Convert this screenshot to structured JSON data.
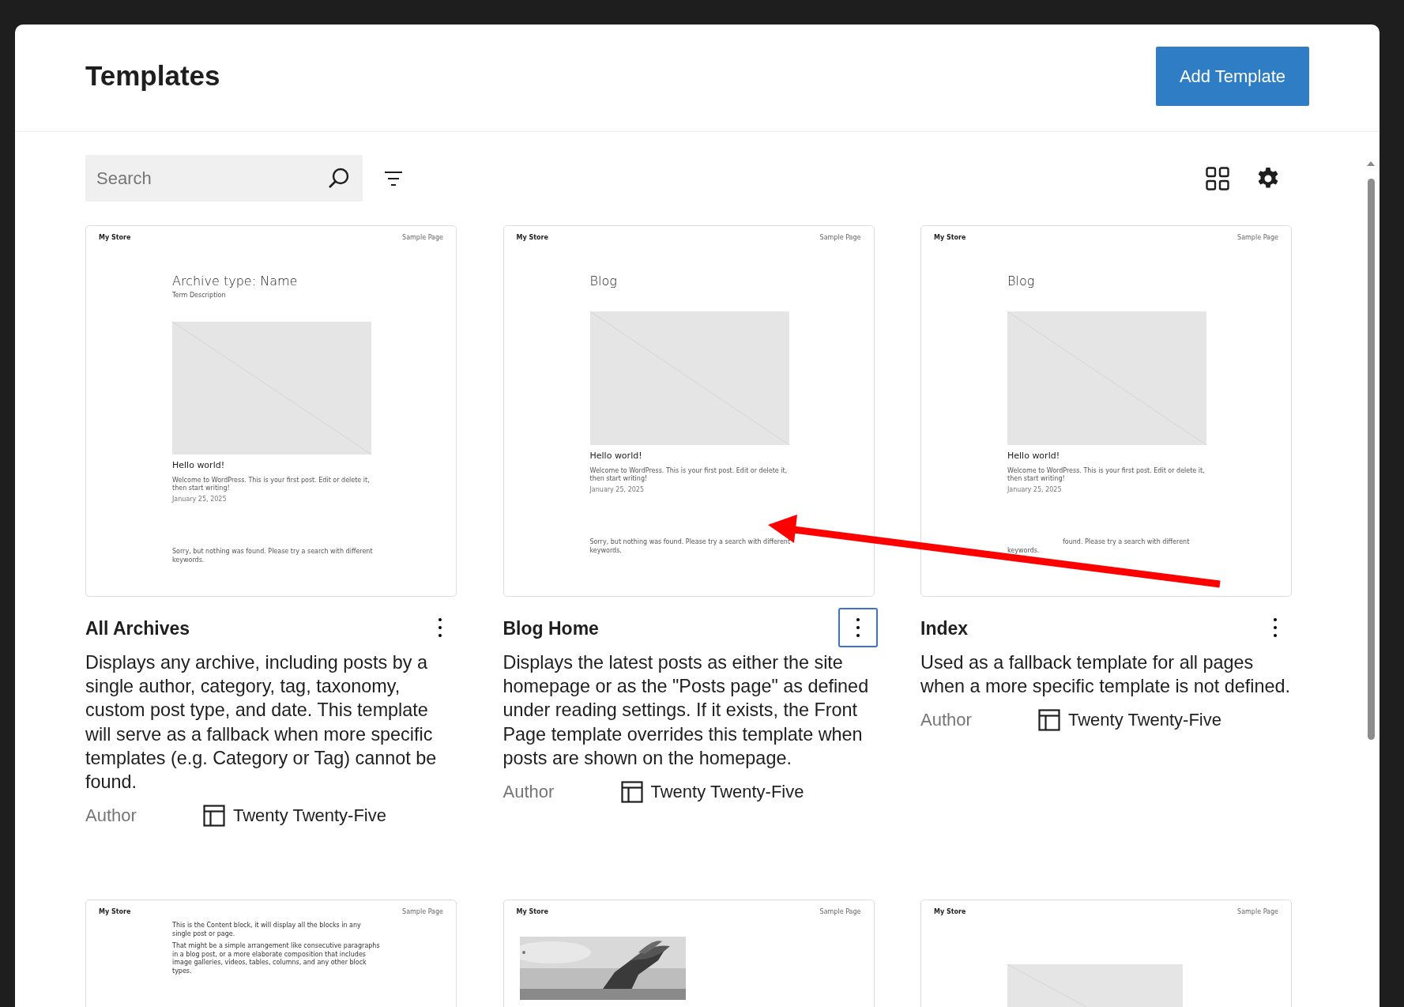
{
  "header": {
    "title": "Templates",
    "add_button": "Add Template"
  },
  "toolbar": {
    "search": {
      "placeholder": "Search"
    }
  },
  "templates": [
    {
      "title": "All Archives",
      "description": "Displays any archive, including posts by a single author, category, tag, taxonomy, custom post type, and date. This template will serve as a fallback when more specific templates (e.g. Category or Tag) cannot be found.",
      "author_label": "Author",
      "theme": "Twenty Twenty-Five",
      "menu_focused": false,
      "preview": {
        "kind": "posts",
        "site_title": "My Store",
        "nav": "Sample Page",
        "heading": "Archive type: Name",
        "subheading": "Term Description",
        "post_title": "Hello world!",
        "excerpt": "Welcome to WordPress. This is your first post. Edit or delete it, then start writing!",
        "date": "January 25, 2025",
        "notice": "Sorry, but nothing was found. Please try a search with different keywords.",
        "notice_covered": false
      }
    },
    {
      "title": "Blog Home",
      "description": "Displays the latest posts as either the site homepage or as the \"Posts page\" as defined under reading settings. If it exists, the Front Page template overrides this template when posts are shown on the homepage.",
      "author_label": "Author",
      "theme": "Twenty Twenty-Five",
      "menu_focused": true,
      "preview": {
        "kind": "posts",
        "site_title": "My Store",
        "nav": "Sample Page",
        "heading": "Blog",
        "post_title": "Hello world!",
        "excerpt": "Welcome to WordPress. This is your first post. Edit or delete it, then start writing!",
        "date": "January 25, 2025",
        "notice": "Sorry, but nothing was found. Please try a search with different keywords.",
        "notice_covered": false
      }
    },
    {
      "title": "Index",
      "description": "Used as a fallback template for all pages when a more specific template is not defined.",
      "author_label": "Author",
      "theme": "Twenty Twenty-Five",
      "menu_focused": false,
      "preview": {
        "kind": "posts",
        "site_title": "My Store",
        "nav": "Sample Page",
        "heading": "Blog",
        "post_title": "Hello world!",
        "excerpt": "Welcome to WordPress. This is your first post. Edit or delete it, then start writing!",
        "date": "January 25, 2025",
        "notice": "found. Please try a search with different keywords.",
        "notice_covered": true
      }
    },
    {
      "preview": {
        "kind": "text",
        "site_title": "My Store",
        "nav": "Sample Page",
        "paragraphs": [
          "This is the Content block, it will display all the blocks in any single post or page.",
          "That might be a simple arrangement like consecutive paragraphs in a blog post, or a more elaborate composition that includes image galleries, videos, tables, columns, and any other block types."
        ]
      }
    },
    {
      "preview": {
        "site_title": "My Store",
        "nav": "Sample Page"
      }
    },
    {
      "preview": {
        "site_title": "My Store",
        "nav": "Sample Page"
      }
    }
  ]
}
